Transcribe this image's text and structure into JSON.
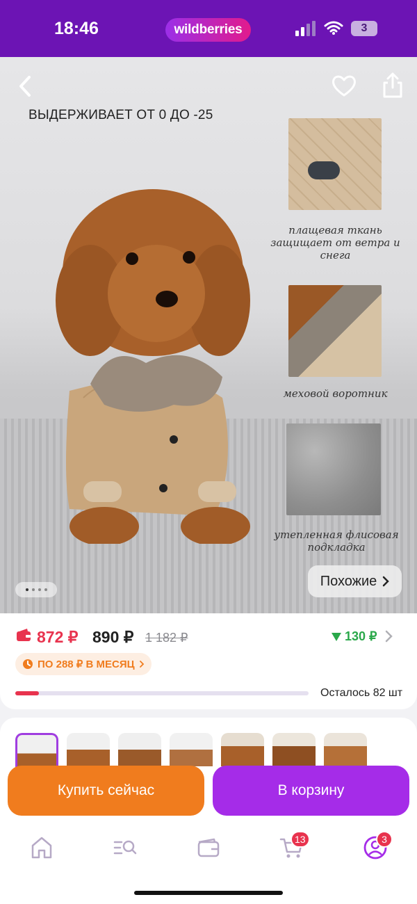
{
  "status_bar": {
    "time": "18:46",
    "brand": "wildberries",
    "battery": "3"
  },
  "gallery": {
    "title": "ВЫДЕРЖИВАЕТ ОТ 0 ДО -25",
    "features": [
      "плащевая ткань защищает от ветра и снега",
      "меховой воротник",
      "утепленная флисовая подкладка"
    ],
    "similar_label": "Похожие",
    "slide_count": 4,
    "active_slide": 0
  },
  "price": {
    "wallet_price": "872 ₽",
    "price": "890 ₽",
    "old_price": "1 182 ₽",
    "cashback": "130 ₽",
    "installment": "ПО 288 ₽ В МЕСЯЦ",
    "stock_label": "Осталось 82 шт",
    "stock_progress": 0.08
  },
  "actions": {
    "buy_now": "Купить сейчас",
    "add_to_cart": "В корзину"
  },
  "tabbar": {
    "cart_badge": "13",
    "profile_badge": "3"
  },
  "colors": {
    "brand_purple": "#6c14b4",
    "accent_red": "#e8334e",
    "buy_orange": "#f07c1e",
    "cart_purple": "#a52ce8",
    "cashback_green": "#2aa84a"
  }
}
